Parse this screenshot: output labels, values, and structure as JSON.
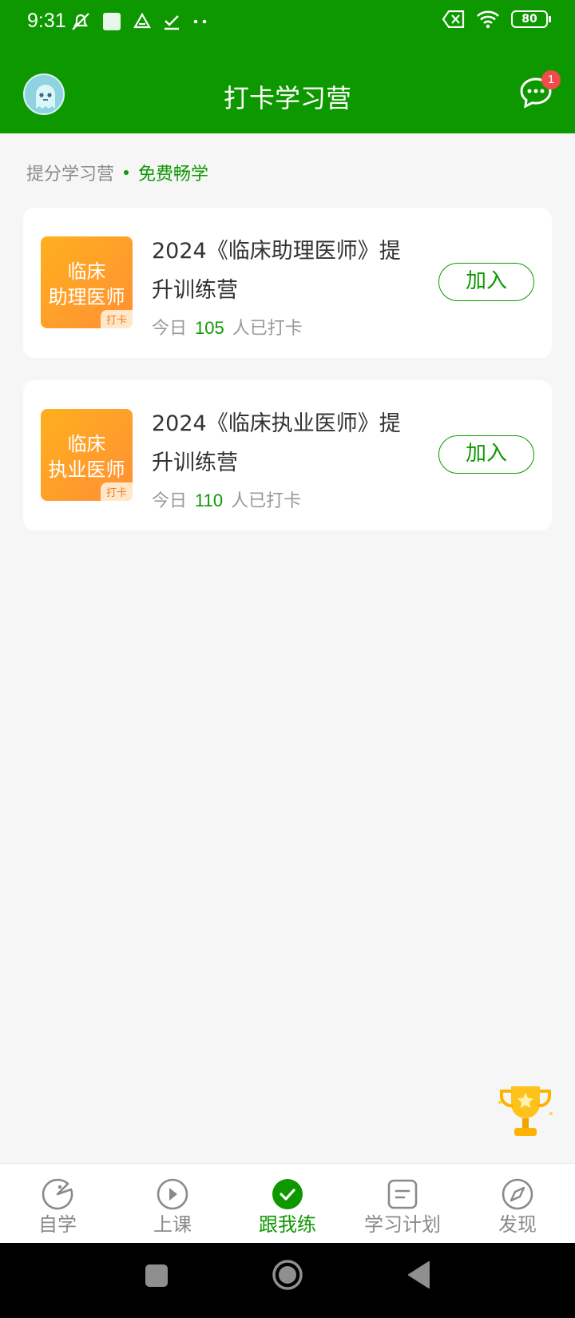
{
  "status_bar": {
    "time": "9:31",
    "battery": "80"
  },
  "header": {
    "title": "打卡学习营",
    "chat_badge": "1"
  },
  "section": {
    "label": "提分学习营",
    "tag": "免费畅学"
  },
  "camps": [
    {
      "thumb_line1": "临床",
      "thumb_line2": "助理医师",
      "thumb_tag": "打卡",
      "title": "2024《临床助理医师》提升训练营",
      "stat_prefix": "今日",
      "count": "105",
      "stat_suffix": "人已打卡",
      "button": "加入"
    },
    {
      "thumb_line1": "临床",
      "thumb_line2": "执业医师",
      "thumb_tag": "打卡",
      "title": "2024《临床执业医师》提升训练营",
      "stat_prefix": "今日",
      "count": "110",
      "stat_suffix": "人已打卡",
      "button": "加入"
    }
  ],
  "tabs": [
    {
      "label": "自学",
      "icon": "pacman-icon"
    },
    {
      "label": "上课",
      "icon": "play-circle-icon"
    },
    {
      "label": "跟我练",
      "icon": "check-circle-icon",
      "active": true
    },
    {
      "label": "学习计划",
      "icon": "plan-icon"
    },
    {
      "label": "发现",
      "icon": "compass-icon"
    }
  ],
  "colors": {
    "brand": "#0d9800",
    "badge": "#f24b4b",
    "thumb": "#ff9d2a"
  }
}
